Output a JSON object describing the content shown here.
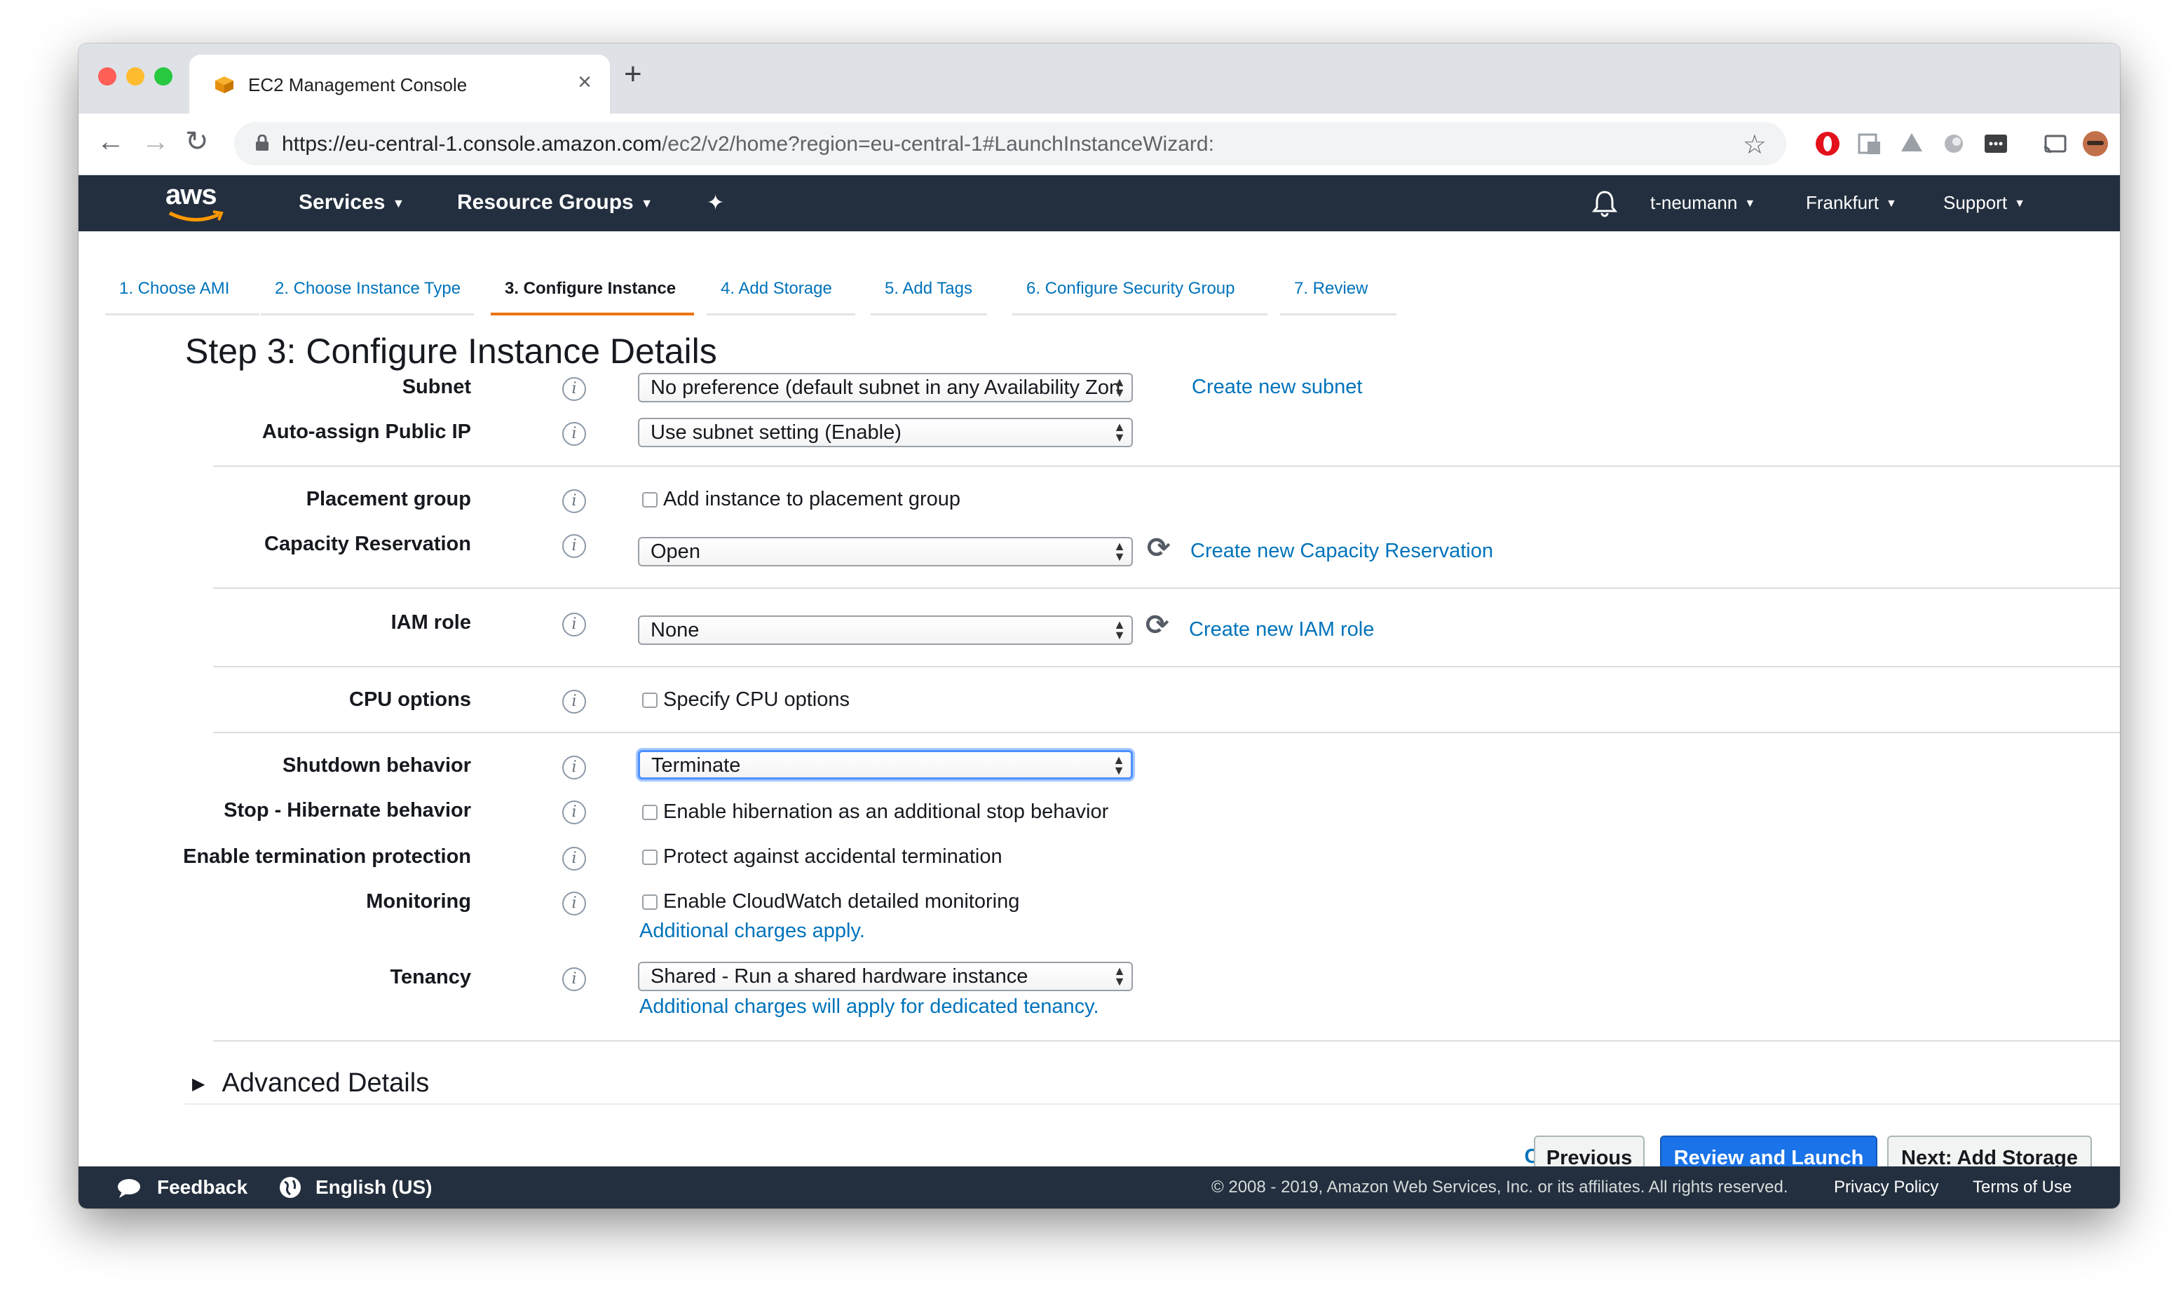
{
  "browser": {
    "tab_title": "EC2 Management Console",
    "tab_close": "×",
    "new_tab": "+",
    "url_main": "https://eu-central-1.console.amazon.com",
    "url_rest": "/ec2/v2/home?region=eu-central-1#LaunchInstanceWizard:",
    "back": "←",
    "forward": "→",
    "reload": "↻",
    "star": "☆",
    "menu": "⋮"
  },
  "aws_nav": {
    "logo": "aws",
    "services": "Services",
    "resource_groups": "Resource Groups",
    "pin": "✦",
    "user": "t-neumann",
    "region": "Frankfurt",
    "support": "Support"
  },
  "wizard_steps": [
    "1. Choose AMI",
    "2. Choose Instance Type",
    "3. Configure Instance",
    "4. Add Storage",
    "5. Add Tags",
    "6. Configure Security Group",
    "7. Review"
  ],
  "page_title": "Step 3: Configure Instance Details",
  "form": {
    "subnet": {
      "label": "Subnet",
      "value": "No preference (default subnet in any Availability Zon",
      "link": "Create new subnet"
    },
    "public_ip": {
      "label": "Auto-assign Public IP",
      "value": "Use subnet setting (Enable)"
    },
    "placement": {
      "label": "Placement group",
      "checkbox": "Add instance to placement group"
    },
    "capacity": {
      "label": "Capacity Reservation",
      "value": "Open",
      "link": "Create new Capacity Reservation"
    },
    "iam": {
      "label": "IAM role",
      "value": "None",
      "link": "Create new IAM role"
    },
    "cpu": {
      "label": "CPU options",
      "checkbox": "Specify CPU options"
    },
    "shutdown": {
      "label": "Shutdown behavior",
      "value": "Terminate"
    },
    "hibernate": {
      "label": "Stop - Hibernate behavior",
      "checkbox": "Enable hibernation as an additional stop behavior"
    },
    "termination": {
      "label": "Enable termination protection",
      "checkbox": "Protect against accidental termination"
    },
    "monitoring": {
      "label": "Monitoring",
      "checkbox": "Enable CloudWatch detailed monitoring",
      "link": "Additional charges apply."
    },
    "tenancy": {
      "label": "Tenancy",
      "value": "Shared - Run a shared hardware instance",
      "link": "Additional charges will apply for dedicated tenancy."
    }
  },
  "info_glyph": "i",
  "refresh_glyph": "⟳",
  "advanced": "Advanced Details",
  "buttons": {
    "cancel": "Cancel",
    "previous": "Previous",
    "review": "Review and Launch",
    "next": "Next: Add Storage"
  },
  "footer": {
    "feedback": "Feedback",
    "language": "English (US)",
    "copyright": "© 2008 - 2019, Amazon Web Services, Inc. or its affiliates. All rights reserved.",
    "privacy": "Privacy Policy",
    "terms": "Terms of Use"
  }
}
